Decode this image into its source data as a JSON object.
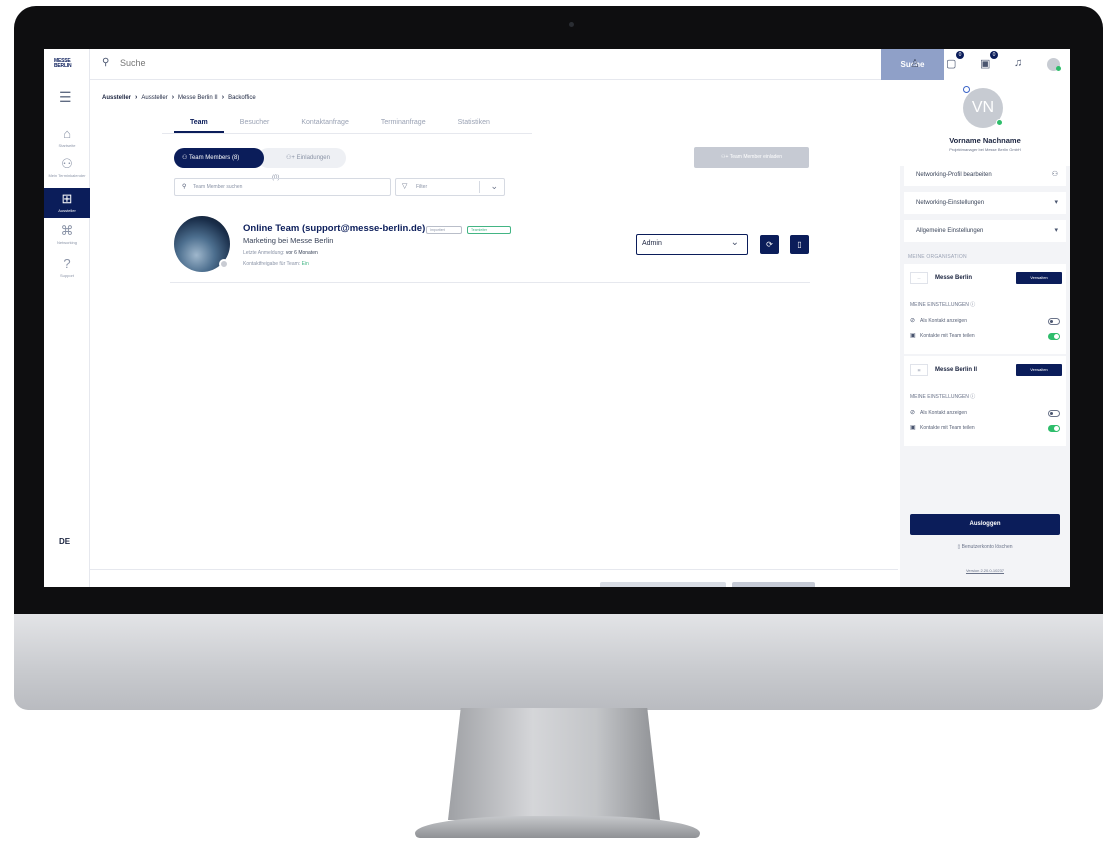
{
  "topbar": {
    "search_placeholder": "Suche",
    "search_button": "Suche",
    "badges": {
      "chat": "0",
      "calendar": "0"
    }
  },
  "rail": {
    "logo_text": "MESSE BERLIN",
    "items": [
      {
        "label": "Startseite",
        "icon": "home-icon"
      },
      {
        "label": "Mein Terminkalender",
        "icon": "people-icon"
      },
      {
        "label": "Aussteller",
        "icon": "grid-icon",
        "active": true
      },
      {
        "label": "Networking",
        "icon": "network-icon"
      },
      {
        "label": "Support",
        "icon": "help-icon"
      }
    ],
    "language": "DE"
  },
  "breadcrumb": [
    "Aussteller",
    "Aussteller",
    "Messe Berlin II",
    "Backoffice"
  ],
  "tabs": [
    "Team",
    "Besucher",
    "Kontaktanfrage",
    "Terminanfrage",
    "Statistiken"
  ],
  "team": {
    "members_pill": "Team Members (8)",
    "invites_pill": "Einladungen (0)",
    "invite_button": "Team Member einladen",
    "search_placeholder": "Team Member suchen",
    "filter_placeholder": "Filter"
  },
  "member": {
    "name": "Online Team (support@messe-berlin.de)",
    "badge_1": "Importiert",
    "badge_2": "Teamleiter",
    "role": "Marketing bei Messe Berlin",
    "last_login_label": "Letzte Anmeldung:",
    "last_login_value": "vor 6 Monaten",
    "contact_share_label": "Kontaktfreigabe für Team:",
    "contact_share_value": "Ein",
    "role_select": "Admin"
  },
  "profile": {
    "initials": "VN",
    "name": "Vorname Nachname",
    "subtitle": "Projektmanager bei Messe Berlin GmbH"
  },
  "panel_menu": [
    "Networking-Profil bearbeiten",
    "Networking-Einstellungen",
    "Allgemeine Einstellungen"
  ],
  "organisation_label": "MEINE ORGANISATION",
  "orgs": [
    {
      "name": "Messe Berlin",
      "button": "Verwalten",
      "settings_head": "MEINE EINSTELLUNGEN",
      "row1": "Als Kontakt anzeigen",
      "row2": "Kontakte mit Team teilen"
    },
    {
      "name": "Messe Berlin II",
      "button": "Verwalten",
      "settings_head": "MEINE EINSTELLUNGEN",
      "row1": "Als Kontakt anzeigen",
      "row2": "Kontakte mit Team teilen"
    }
  ],
  "logout": "Ausloggen",
  "delete_account": "Benutzerkonto löschen",
  "version": "Version 2.20.0-10237",
  "colors": {
    "brand": "#0b1d5a",
    "accent_green": "#2ebd6b",
    "search_button": "#8fa0c8"
  }
}
